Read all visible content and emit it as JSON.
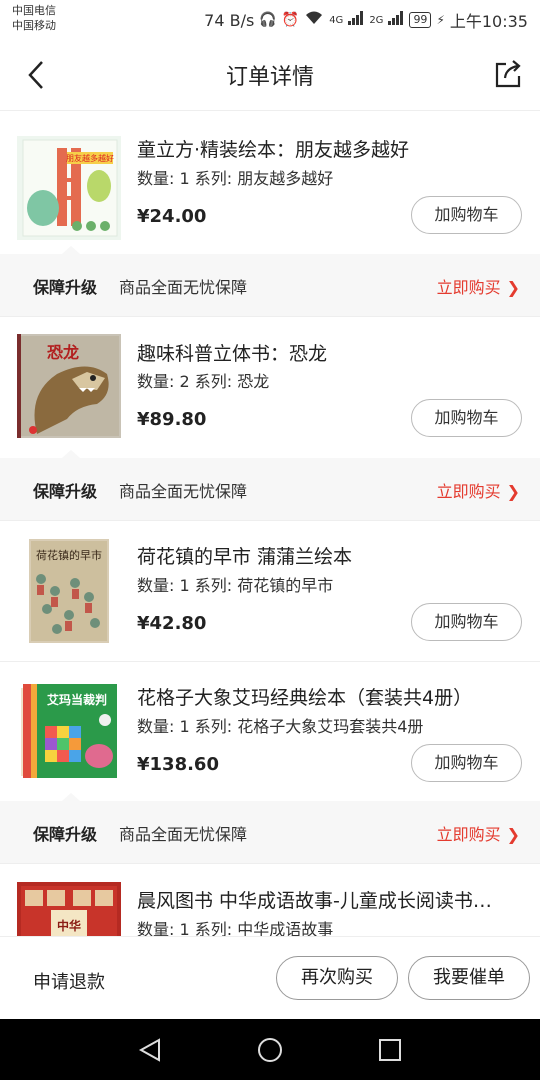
{
  "status": {
    "carrier1": "中国电信",
    "carrier2": "中国移动",
    "speed": "74 B/s",
    "net1": "4G",
    "net2": "2G",
    "battery": "99",
    "time": "上午10:35"
  },
  "nav": {
    "title": "订单详情"
  },
  "products": [
    {
      "name": "童立方·精装绘本：朋友越多越好",
      "meta": "数量: 1 系列: 朋友越多越好",
      "price": "¥24.00",
      "cart": "加购物车",
      "cover_text": "朋友越多越好"
    },
    {
      "name": "趣味科普立体书：恐龙",
      "meta": "数量: 2 系列: 恐龙",
      "price": "¥89.80",
      "cart": "加购物车",
      "cover_text": "恐龙"
    },
    {
      "name": "荷花镇的早市 蒲蒲兰绘本",
      "meta": "数量: 1 系列: 荷花镇的早市",
      "price": "¥42.80",
      "cart": "加购物车",
      "cover_text": "荷花镇的早市"
    },
    {
      "name": "花格子大象艾玛经典绘本（套装共4册）",
      "meta": "数量: 1 系列: 花格子大象艾玛套装共4册",
      "price": "¥138.60",
      "cart": "加购物车",
      "cover_text": "艾玛当裁判"
    },
    {
      "name": "晨风图书 中华成语故事-儿童成长阅读书…",
      "meta": "数量: 1 系列: 中华成语故事",
      "cover_text": "中华"
    }
  ],
  "guarantee": {
    "title": "保障升级",
    "desc": "商品全面无忧保障",
    "link": "立即购买",
    "chevron": "❯"
  },
  "bottom": {
    "refund": "申请退款",
    "rebuy": "再次购买",
    "urge": "我要催单"
  },
  "colors": {
    "accent": "#e43b2f",
    "guarantee_bg": "#f7f7f7"
  }
}
